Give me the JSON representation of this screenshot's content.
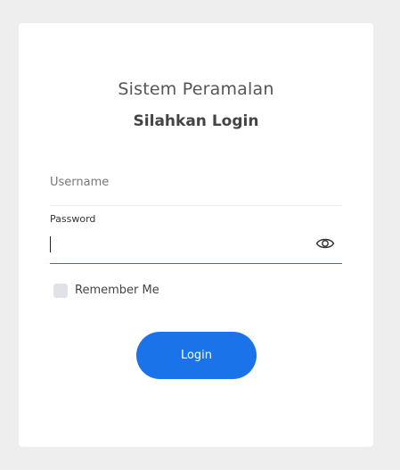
{
  "card": {
    "title": "Sistem Peramalan",
    "subtitle": "Silahkan Login"
  },
  "form": {
    "username": {
      "placeholder": "Username",
      "value": ""
    },
    "password": {
      "label": "Password",
      "value": "",
      "toggle_icon": "eye-icon"
    },
    "remember": {
      "label": "Remember Me",
      "checked": false
    },
    "submit_label": "Login"
  },
  "colors": {
    "accent": "#1a73e8",
    "background": "#eeeeee",
    "card": "#ffffff"
  }
}
